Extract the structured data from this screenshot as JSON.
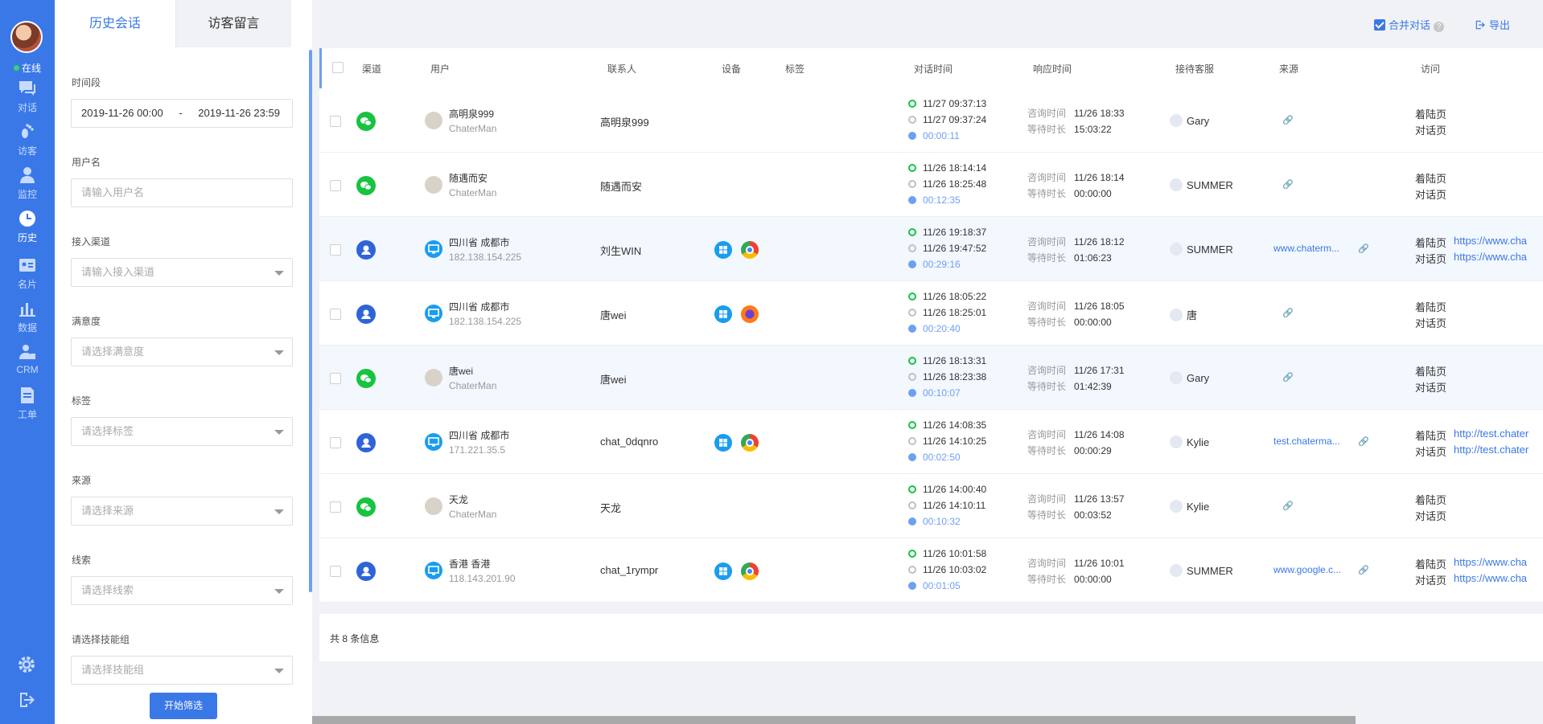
{
  "nav": {
    "status": "在线",
    "items": [
      {
        "label": "对话"
      },
      {
        "label": "访客"
      },
      {
        "label": "监控"
      },
      {
        "label": "历史"
      },
      {
        "label": "名片"
      },
      {
        "label": "数据"
      },
      {
        "label": "CRM"
      },
      {
        "label": "工单"
      }
    ]
  },
  "tabs": [
    "历史会话",
    "访客留言"
  ],
  "toolbar": {
    "merge_label": "合并对话",
    "help": "?",
    "export_label": "导出"
  },
  "filter": {
    "time_label": "时间段",
    "date_start": "2019-11-26 00:00",
    "date_sep": "-",
    "date_end": "2019-11-26 23:59",
    "user_label": "用户名",
    "user_placeholder": "请输入用户名",
    "channel_label": "接入渠道",
    "channel_placeholder": "请输入接入渠道",
    "satisfaction_label": "满意度",
    "satisfaction_placeholder": "请选择满意度",
    "tag_label": "标签",
    "tag_placeholder": "请选择标签",
    "source_label": "来源",
    "source_placeholder": "请选择来源",
    "clue_label": "线索",
    "clue_placeholder": "请选择线索",
    "skill_label": "请选择技能组",
    "skill_placeholder": "请选择技能组",
    "submit": "开始筛选"
  },
  "table": {
    "headers": [
      "渠道",
      "用户",
      "联系人",
      "设备",
      "标签",
      "对话时间",
      "响应时间",
      "接待客服",
      "来源",
      "访问"
    ],
    "resp_keys": {
      "consult": "咨询时间",
      "wait": "等待时长"
    },
    "visit_keys": {
      "landing": "着陆页",
      "chat": "对话页"
    },
    "rows": [
      {
        "channel": "wx",
        "user": "高明泉999",
        "user_sub": "ChaterMan",
        "contact": "高明泉999",
        "devices": [],
        "start": "11/27 09:37:13",
        "end": "11/27 09:37:24",
        "duration": "00:00:11",
        "consult": "11/26 18:33",
        "wait": "15:03:22",
        "agent": "Gary",
        "source": "",
        "landing_url": "",
        "chat_url": ""
      },
      {
        "channel": "wx",
        "user": "随遇而安",
        "user_sub": "ChaterMan",
        "contact": "随遇而安",
        "devices": [],
        "start": "11/26 18:14:14",
        "end": "11/26 18:25:48",
        "duration": "00:12:35",
        "consult": "11/26 18:14",
        "wait": "00:00:00",
        "agent": "SUMMER",
        "source": "",
        "landing_url": "",
        "chat_url": ""
      },
      {
        "channel": "web",
        "user": "四川省 成都市",
        "user_sub": "182.138.154.225",
        "contact": "刘生WIN",
        "devices": [
          "win",
          "chrome"
        ],
        "start": "11/26 19:18:37",
        "end": "11/26 19:47:52",
        "duration": "00:29:16",
        "consult": "11/26 18:12",
        "wait": "01:06:23",
        "agent": "SUMMER",
        "source": "www.chaterm...",
        "landing_url": "https://www.cha",
        "chat_url": "https://www.cha"
      },
      {
        "channel": "web",
        "user": "四川省 成都市",
        "user_sub": "182.138.154.225",
        "contact": "唐wei",
        "devices": [
          "win",
          "firefox"
        ],
        "start": "11/26 18:05:22",
        "end": "11/26 18:25:01",
        "duration": "00:20:40",
        "consult": "11/26 18:05",
        "wait": "00:00:00",
        "agent": "唐",
        "source": "",
        "landing_url": "",
        "chat_url": ""
      },
      {
        "channel": "wx",
        "user": "唐wei",
        "user_sub": "ChaterMan",
        "contact": "唐wei",
        "devices": [],
        "start": "11/26 18:13:31",
        "end": "11/26 18:23:38",
        "duration": "00:10:07",
        "consult": "11/26 17:31",
        "wait": "01:42:39",
        "agent": "Gary",
        "source": "",
        "landing_url": "",
        "chat_url": ""
      },
      {
        "channel": "web",
        "user": "四川省 成都市",
        "user_sub": "171.221.35.5",
        "contact": "chat_0dqnro",
        "devices": [
          "win",
          "chrome"
        ],
        "start": "11/26 14:08:35",
        "end": "11/26 14:10:25",
        "duration": "00:02:50",
        "consult": "11/26 14:08",
        "wait": "00:00:29",
        "agent": "Kylie",
        "source": "test.chaterma...",
        "landing_url": "http://test.chater",
        "chat_url": "http://test.chater"
      },
      {
        "channel": "wx",
        "user": "天龙",
        "user_sub": "ChaterMan",
        "contact": "天龙",
        "devices": [],
        "start": "11/26 14:00:40",
        "end": "11/26 14:10:11",
        "duration": "00:10:32",
        "consult": "11/26 13:57",
        "wait": "00:03:52",
        "agent": "Kylie",
        "source": "",
        "landing_url": "",
        "chat_url": ""
      },
      {
        "channel": "web",
        "user": "香港 香港",
        "user_sub": "118.143.201.90",
        "contact": "chat_1rympr",
        "devices": [
          "win",
          "chrome"
        ],
        "start": "11/26 10:01:58",
        "end": "11/26 10:03:02",
        "duration": "00:01:05",
        "consult": "11/26 10:01",
        "wait": "00:00:00",
        "agent": "SUMMER",
        "source": "www.google.c...",
        "landing_url": "https://www.cha",
        "chat_url": "https://www.cha"
      }
    ],
    "total": "共 8 条信息"
  },
  "colors": {
    "primary": "#3a78e7",
    "wechat": "#17c33f",
    "web": "#2f64d9"
  }
}
